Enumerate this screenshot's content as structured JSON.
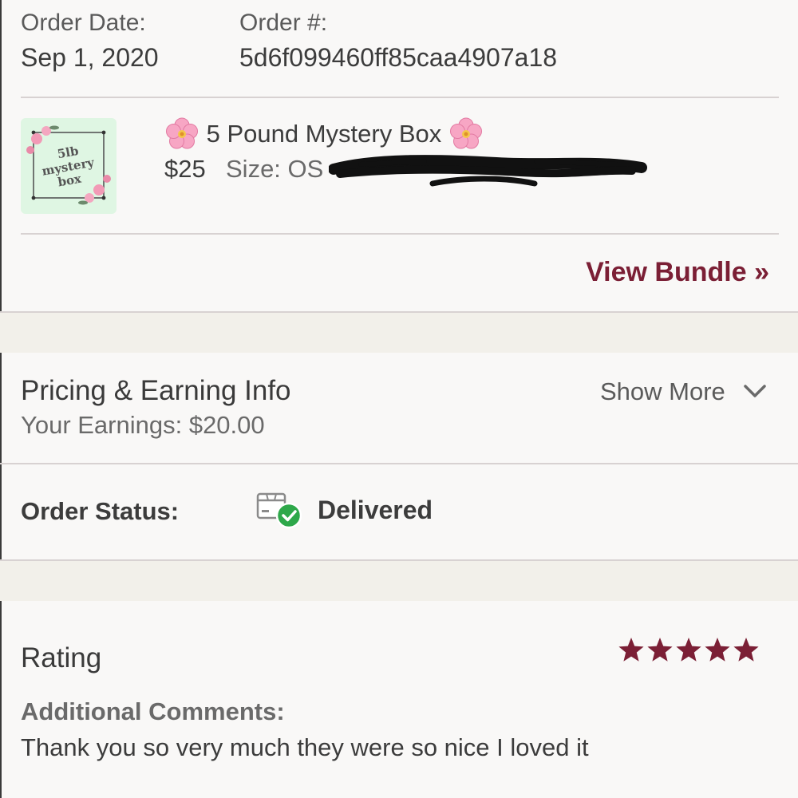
{
  "order": {
    "date_label": "Order Date:",
    "date_value": "Sep 1, 2020",
    "number_label": "Order #:",
    "number_value": "5d6f099460ff85caa4907a18"
  },
  "item": {
    "thumbnail_text": [
      "5lb",
      "mystery",
      "box"
    ],
    "title": "5 Pound Mystery Box",
    "title_icons": [
      "cherry-blossom-icon",
      "cherry-blossom-icon"
    ],
    "price": "$25",
    "size": "Size: OS",
    "redacted": true
  },
  "bundle": {
    "link_label": "View Bundle »"
  },
  "pricing": {
    "title": "Pricing & Earning Info",
    "earnings": "Your Earnings: $20.00",
    "show_more_label": "Show More"
  },
  "status": {
    "label": "Order Status:",
    "value": "Delivered",
    "icon": "package-delivered-icon"
  },
  "rating": {
    "label": "Rating",
    "stars": 5,
    "comments_label": "Additional Comments:",
    "comments_text": "Thank you so very much they were so nice I loved it"
  },
  "colors": {
    "accent": "#7b1f35",
    "status_check": "#2ea84a",
    "background": "#f9f8f7"
  }
}
